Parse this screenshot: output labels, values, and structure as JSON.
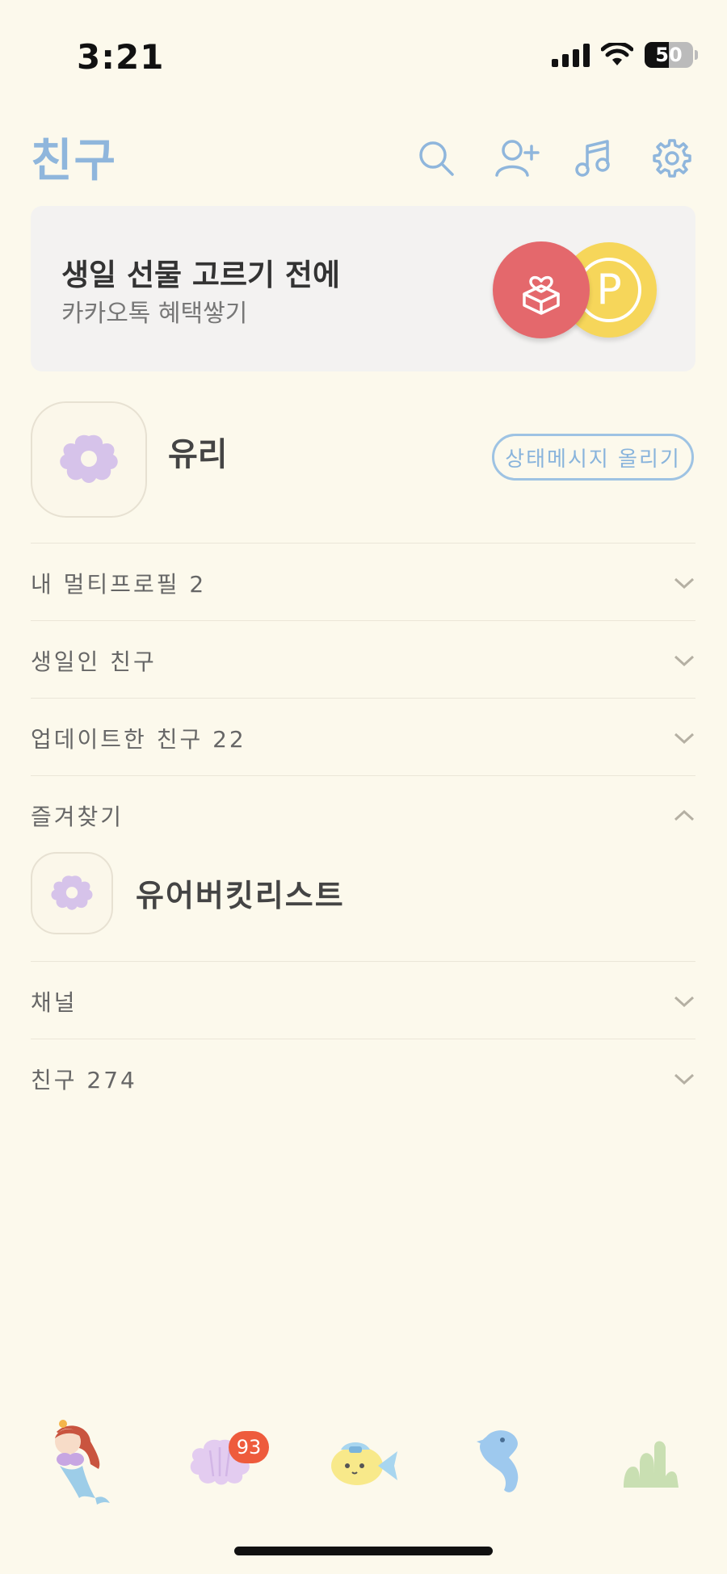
{
  "status_bar": {
    "time": "3:21",
    "battery": "50",
    "battery_level": 0.5
  },
  "header": {
    "title": "친구",
    "icons": [
      "search-icon",
      "add-friend-icon",
      "music-icon",
      "settings-icon"
    ]
  },
  "banner": {
    "title": "생일 선물 고르기 전에",
    "subtitle": "카카오톡 혜택쌓기",
    "coin_letter": "P"
  },
  "profile": {
    "name": "유리",
    "status_button": "상태메시지 올리기"
  },
  "sections": [
    {
      "label": "내 멀티프로필 2",
      "expanded": false
    },
    {
      "label": "생일인 친구",
      "expanded": false
    },
    {
      "label": "업데이트한 친구 22",
      "expanded": false
    },
    {
      "label": "즐겨찾기",
      "expanded": true
    },
    {
      "label": "채널",
      "expanded": false
    },
    {
      "label": "친구 274",
      "expanded": false
    }
  ],
  "favorites": [
    {
      "name": "유어버킷리스트"
    }
  ],
  "tab_bar": {
    "tabs": [
      "friends-tab",
      "chats-tab",
      "view-tab",
      "shopping-tab",
      "more-tab"
    ],
    "chat_badge": "93"
  },
  "colors": {
    "background": "#fcf9ec",
    "accent_blue": "#8fb6dc",
    "gift_red": "#e4686c",
    "coin_yellow": "#f6d65a",
    "badge_orange": "#ee5b3c"
  }
}
